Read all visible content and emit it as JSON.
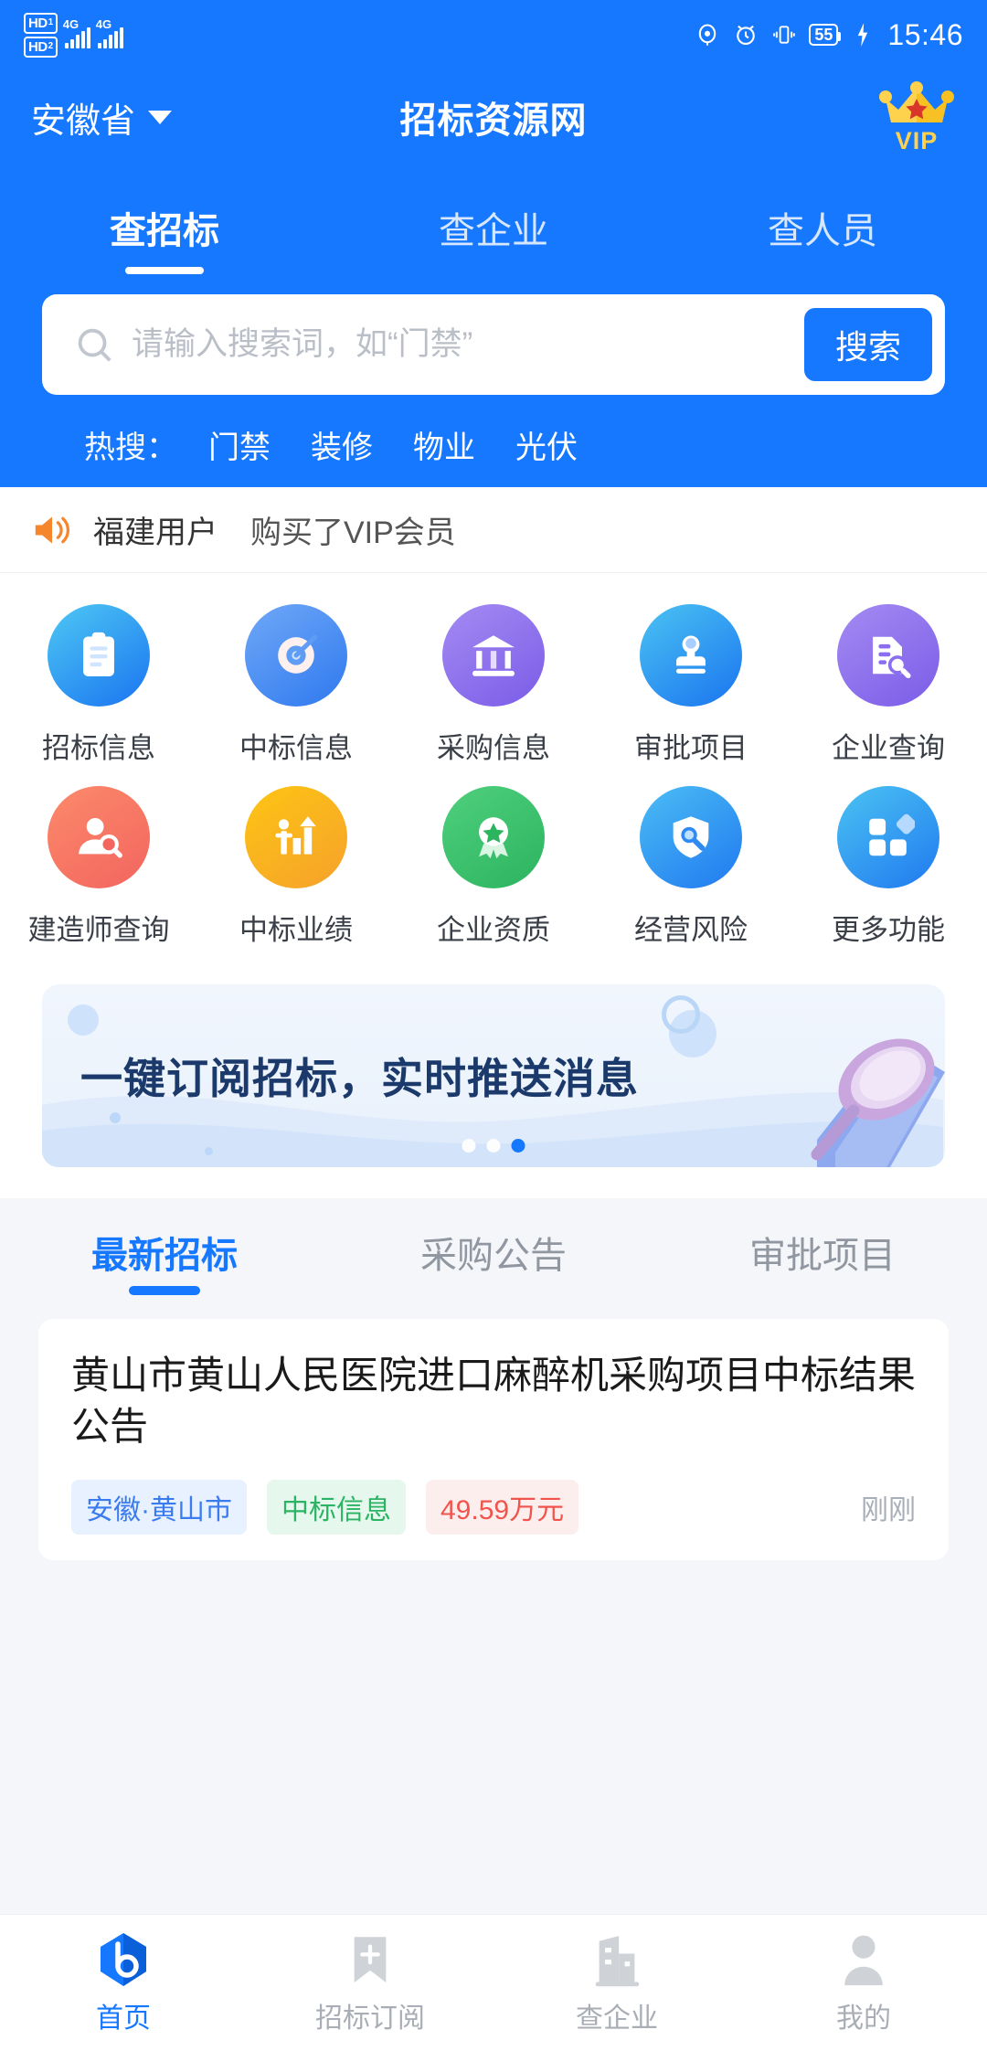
{
  "statusbar": {
    "sim1": "HD",
    "sim1_num": "1",
    "sim2": "HD",
    "sim2_num": "2",
    "net1": "4G",
    "net2": "4G",
    "battery": "55",
    "time": "15:46"
  },
  "header": {
    "region": "安徽省",
    "title": "招标资源网",
    "vip_label": "VIP"
  },
  "tabs": [
    {
      "label": "查招标",
      "active": true
    },
    {
      "label": "查企业",
      "active": false
    },
    {
      "label": "查人员",
      "active": false
    }
  ],
  "search": {
    "placeholder": "请输入搜索词，如“门禁”",
    "value": "",
    "button": "搜索"
  },
  "hot": {
    "label": "热搜：",
    "items": [
      "门禁",
      "装修",
      "物业",
      "光伏"
    ]
  },
  "notice": {
    "user": "福建用户",
    "action": "购买了VIP会员"
  },
  "grid": [
    {
      "label": "招标信息",
      "icon": "clipboard-icon",
      "c1": "#4ec8f4",
      "c2": "#1a74f0"
    },
    {
      "label": "中标信息",
      "icon": "target-icon",
      "c1": "#6fa8f7",
      "c2": "#2f79ef"
    },
    {
      "label": "采购信息",
      "icon": "bank-icon",
      "c1": "#a48bf2",
      "c2": "#7b5ce8"
    },
    {
      "label": "审批项目",
      "icon": "stamp-icon",
      "c1": "#4bc3f2",
      "c2": "#1a74f0"
    },
    {
      "label": "企业查询",
      "icon": "document-search-icon",
      "c1": "#a48bf2",
      "c2": "#7b5ce8"
    },
    {
      "label": "建造师查询",
      "icon": "person-search-icon",
      "c1": "#fb8a6a",
      "c2": "#f3655f"
    },
    {
      "label": "中标业绩",
      "icon": "growth-chart-icon",
      "c1": "#fdc513",
      "c2": "#f6a12c"
    },
    {
      "label": "企业资质",
      "icon": "medal-icon",
      "c1": "#4fcf7d",
      "c2": "#2cb45f"
    },
    {
      "label": "经营风险",
      "icon": "shield-search-icon",
      "c1": "#4bbdf4",
      "c2": "#2079f0"
    },
    {
      "label": "更多功能",
      "icon": "grid-more-icon",
      "c1": "#4bc3f2",
      "c2": "#2079f0"
    }
  ],
  "banner": {
    "text": "一键订阅招标，实时推送消息",
    "dots": 3,
    "active_dot": 3
  },
  "list_tabs": [
    {
      "label": "最新招标",
      "active": true
    },
    {
      "label": "采购公告",
      "active": false
    },
    {
      "label": "审批项目",
      "active": false
    }
  ],
  "list_items": [
    {
      "title": "黄山市黄山人民医院进口麻醉机采购项目中标结果公告",
      "region": "安徽·黄山市",
      "type": "中标信息",
      "price": "49.59万元",
      "time": "刚刚"
    }
  ],
  "bottom_nav": [
    {
      "label": "首页",
      "icon": "home-logo-icon",
      "active": true
    },
    {
      "label": "招标订阅",
      "icon": "bookmark-plus-icon",
      "active": false
    },
    {
      "label": "查企业",
      "icon": "building-icon",
      "active": false
    },
    {
      "label": "我的",
      "icon": "person-icon",
      "active": false
    }
  ],
  "colors": {
    "brand": "#1677ff",
    "accent_gold": "#ffd24d",
    "notice_orange": "#f5862b"
  }
}
